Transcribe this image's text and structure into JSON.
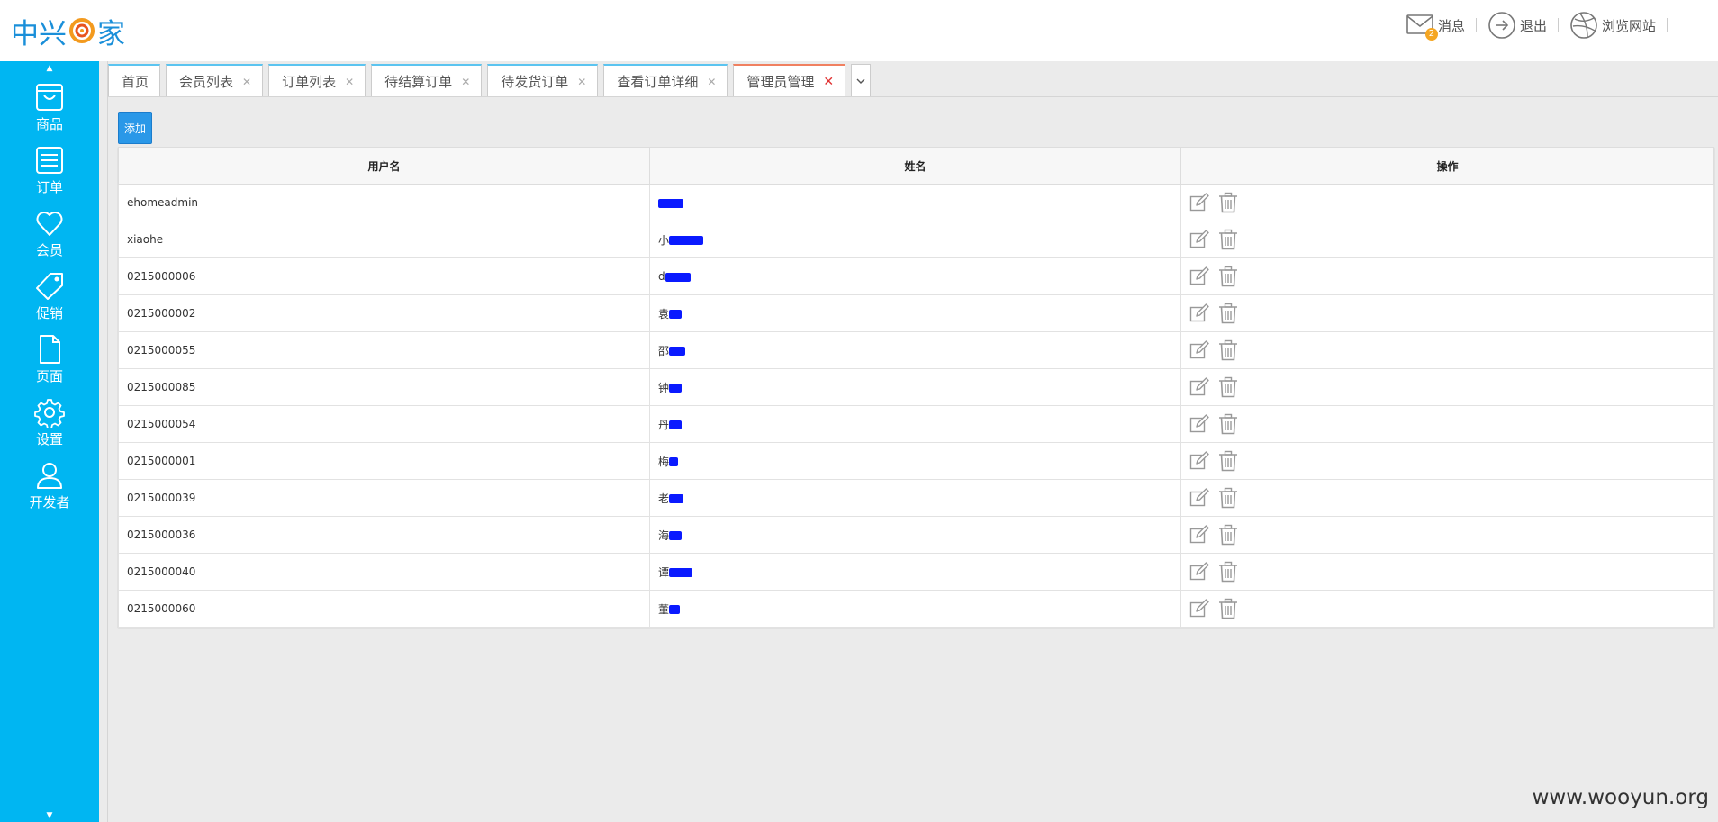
{
  "header": {
    "logo_left": "中兴",
    "logo_right": "家",
    "links": [
      {
        "label": "消息",
        "badge": "2"
      },
      {
        "label": "退出"
      },
      {
        "label": "浏览网站"
      }
    ]
  },
  "sidebar": {
    "items": [
      {
        "label": "商品",
        "icon": "shopping-bag-icon"
      },
      {
        "label": "订单",
        "icon": "list-icon"
      },
      {
        "label": "会员",
        "icon": "heart-icon"
      },
      {
        "label": "促销",
        "icon": "tag-icon"
      },
      {
        "label": "页面",
        "icon": "page-icon"
      },
      {
        "label": "设置",
        "icon": "gear-icon"
      },
      {
        "label": "开发者",
        "icon": "user-icon"
      }
    ]
  },
  "tabs": [
    {
      "label": "首页",
      "closable": false
    },
    {
      "label": "会员列表",
      "closable": true
    },
    {
      "label": "订单列表",
      "closable": true
    },
    {
      "label": "待结算订单",
      "closable": true
    },
    {
      "label": "待发货订单",
      "closable": true
    },
    {
      "label": "查看订单详细",
      "closable": true
    },
    {
      "label": "管理员管理",
      "closable": true,
      "active": true
    }
  ],
  "toolbar": {
    "add_label": "添加"
  },
  "table": {
    "headers": [
      "用户名",
      "姓名",
      "操作"
    ],
    "rows": [
      {
        "username": "ehomeadmin",
        "name_visible": ""
      },
      {
        "username": "xiaohe",
        "name_visible": "小"
      },
      {
        "username": "0215000006",
        "name_visible": "d"
      },
      {
        "username": "0215000002",
        "name_visible": "袁"
      },
      {
        "username": "0215000055",
        "name_visible": "邵"
      },
      {
        "username": "0215000085",
        "name_visible": "钟"
      },
      {
        "username": "0215000054",
        "name_visible": "丹"
      },
      {
        "username": "0215000001",
        "name_visible": "梅"
      },
      {
        "username": "0215000039",
        "name_visible": "老"
      },
      {
        "username": "0215000036",
        "name_visible": "海"
      },
      {
        "username": "0215000040",
        "name_visible": "谭"
      },
      {
        "username": "0215000060",
        "name_visible": "董"
      }
    ]
  },
  "watermark": "www.wooyun.org",
  "colors": {
    "sidebar": "#00b6f2",
    "add_button": "#2a98e8",
    "redaction": "#0a1aff"
  }
}
